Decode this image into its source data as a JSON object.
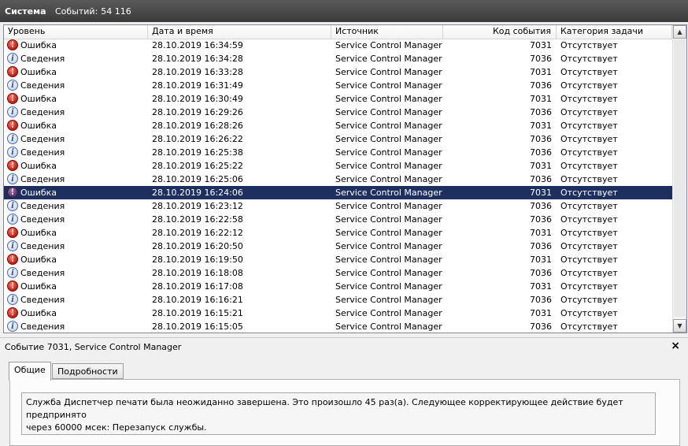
{
  "header": {
    "title": "Система",
    "count_label": "Событий:",
    "count_value": "54 116"
  },
  "columns": [
    "Уровень",
    "Дата и время",
    "Источник",
    "Код события",
    "Категория задачи"
  ],
  "events": [
    {
      "level": "Ошибка",
      "type": "error",
      "datetime": "28.10.2019 16:34:59",
      "source": "Service Control Manager",
      "code": "7031",
      "category": "Отсутствует"
    },
    {
      "level": "Сведения",
      "type": "info",
      "datetime": "28.10.2019 16:34:28",
      "source": "Service Control Manager",
      "code": "7036",
      "category": "Отсутствует"
    },
    {
      "level": "Ошибка",
      "type": "error",
      "datetime": "28.10.2019 16:33:28",
      "source": "Service Control Manager",
      "code": "7031",
      "category": "Отсутствует"
    },
    {
      "level": "Сведения",
      "type": "info",
      "datetime": "28.10.2019 16:31:49",
      "source": "Service Control Manager",
      "code": "7036",
      "category": "Отсутствует"
    },
    {
      "level": "Ошибка",
      "type": "error",
      "datetime": "28.10.2019 16:30:49",
      "source": "Service Control Manager",
      "code": "7031",
      "category": "Отсутствует"
    },
    {
      "level": "Сведения",
      "type": "info",
      "datetime": "28.10.2019 16:29:26",
      "source": "Service Control Manager",
      "code": "7036",
      "category": "Отсутствует"
    },
    {
      "level": "Ошибка",
      "type": "error",
      "datetime": "28.10.2019 16:28:26",
      "source": "Service Control Manager",
      "code": "7031",
      "category": "Отсутствует"
    },
    {
      "level": "Сведения",
      "type": "info",
      "datetime": "28.10.2019 16:26:22",
      "source": "Service Control Manager",
      "code": "7036",
      "category": "Отсутствует"
    },
    {
      "level": "Сведения",
      "type": "info",
      "datetime": "28.10.2019 16:25:38",
      "source": "Service Control Manager",
      "code": "7036",
      "category": "Отсутствует"
    },
    {
      "level": "Ошибка",
      "type": "error",
      "datetime": "28.10.2019 16:25:22",
      "source": "Service Control Manager",
      "code": "7031",
      "category": "Отсутствует"
    },
    {
      "level": "Сведения",
      "type": "info",
      "datetime": "28.10.2019 16:25:06",
      "source": "Service Control Manager",
      "code": "7036",
      "category": "Отсутствует"
    },
    {
      "level": "Ошибка",
      "type": "error",
      "datetime": "28.10.2019 16:24:06",
      "source": "Service Control Manager",
      "code": "7031",
      "category": "Отсутствует",
      "selected": true
    },
    {
      "level": "Сведения",
      "type": "info",
      "datetime": "28.10.2019 16:23:12",
      "source": "Service Control Manager",
      "code": "7036",
      "category": "Отсутствует"
    },
    {
      "level": "Сведения",
      "type": "info",
      "datetime": "28.10.2019 16:22:58",
      "source": "Service Control Manager",
      "code": "7036",
      "category": "Отсутствует"
    },
    {
      "level": "Ошибка",
      "type": "error",
      "datetime": "28.10.2019 16:22:12",
      "source": "Service Control Manager",
      "code": "7031",
      "category": "Отсутствует"
    },
    {
      "level": "Сведения",
      "type": "info",
      "datetime": "28.10.2019 16:20:50",
      "source": "Service Control Manager",
      "code": "7036",
      "category": "Отсутствует"
    },
    {
      "level": "Ошибка",
      "type": "error",
      "datetime": "28.10.2019 16:19:50",
      "source": "Service Control Manager",
      "code": "7031",
      "category": "Отсутствует"
    },
    {
      "level": "Сведения",
      "type": "info",
      "datetime": "28.10.2019 16:18:08",
      "source": "Service Control Manager",
      "code": "7036",
      "category": "Отсутствует"
    },
    {
      "level": "Ошибка",
      "type": "error",
      "datetime": "28.10.2019 16:17:08",
      "source": "Service Control Manager",
      "code": "7031",
      "category": "Отсутствует"
    },
    {
      "level": "Сведения",
      "type": "info",
      "datetime": "28.10.2019 16:16:21",
      "source": "Service Control Manager",
      "code": "7036",
      "category": "Отсутствует"
    },
    {
      "level": "Ошибка",
      "type": "error",
      "datetime": "28.10.2019 16:15:21",
      "source": "Service Control Manager",
      "code": "7031",
      "category": "Отсутствует"
    },
    {
      "level": "Сведения",
      "type": "info",
      "datetime": "28.10.2019 16:15:05",
      "source": "Service Control Manager",
      "code": "7036",
      "category": "Отсутствует"
    }
  ],
  "detail": {
    "title": "Событие 7031, Service Control Manager",
    "close_glyph": "×",
    "tabs": [
      "Общие",
      "Подробности"
    ],
    "active_tab": "Общие",
    "message_line1": "Служба Диспетчер печати была неожиданно завершена. Это произошло 45 раз(а). Следующее корректирующее действие будет предпринято",
    "message_line2": "через 60000 мсек: Перезапуск службы."
  },
  "icons": {
    "error": "error-icon",
    "info": "info-icon"
  },
  "colors": {
    "selection": "#1c2f5f",
    "titlebar": "#4a4a4a",
    "error": "#c01a10",
    "info": "#2b4fa8"
  }
}
